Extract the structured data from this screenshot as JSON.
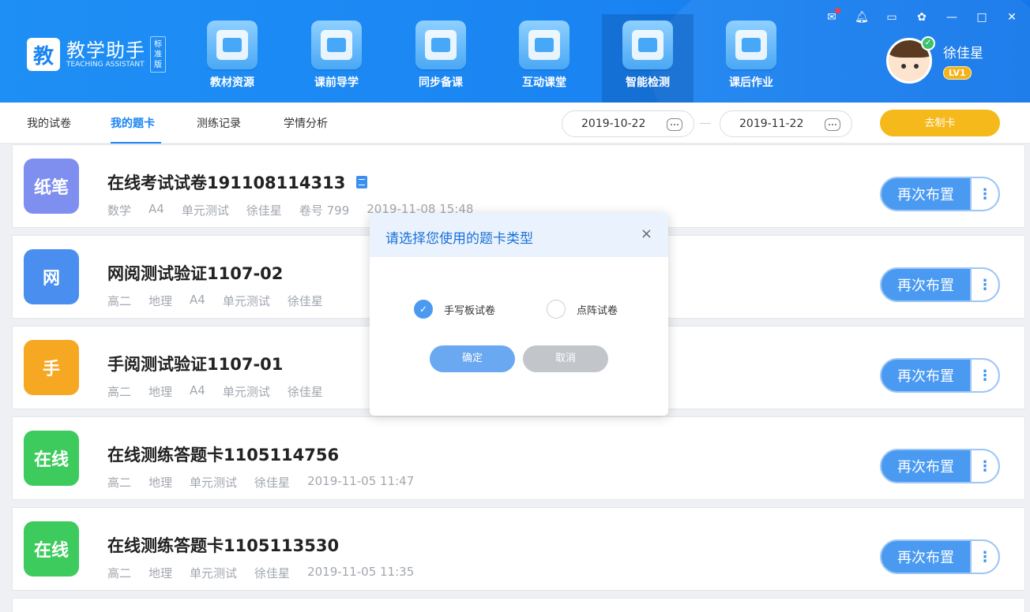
{
  "app": {
    "logo_char": "教",
    "name": "教学助手",
    "name_en": "TEACHING ASSISTANT",
    "edition": [
      "标",
      "准",
      "版"
    ]
  },
  "nav": [
    {
      "label": "教材资源",
      "icon": "textbook-icon"
    },
    {
      "label": "课前导学",
      "icon": "upload-guide-icon"
    },
    {
      "label": "同步备课",
      "icon": "pencil-paper-icon"
    },
    {
      "label": "互动课堂",
      "icon": "monitor-icon"
    },
    {
      "label": "智能检测",
      "icon": "clipboard-check-icon",
      "active": true
    },
    {
      "label": "课后作业",
      "icon": "backpack-icon"
    }
  ],
  "user": {
    "name": "徐佳星",
    "level": "LV1"
  },
  "tabs": [
    {
      "label": "我的试卷"
    },
    {
      "label": "我的题卡",
      "active": true
    },
    {
      "label": "测练记录"
    },
    {
      "label": "学情分析"
    }
  ],
  "filter": {
    "date_from": "2019-10-22",
    "date_to": "2019-11-22",
    "make_card_label": "去制卡"
  },
  "list": [
    {
      "badge": "纸笔",
      "badge_color": "#7f8ff0",
      "title": "在线考试试卷191108114313",
      "has_doc_icon": true,
      "meta": [
        "数学",
        "A4",
        "单元测试",
        "徐佳星",
        "卷号 799",
        "2019-11-08 15:48"
      ]
    },
    {
      "badge": "网",
      "badge_color": "#4a8ff0",
      "title": "网阅测试验证1107-02",
      "meta": [
        "高二",
        "地理",
        "A4",
        "单元测试",
        "徐佳星"
      ]
    },
    {
      "badge": "手",
      "badge_color": "#f7a823",
      "title": "手阅测试验证1107-01",
      "meta": [
        "高二",
        "地理",
        "A4",
        "单元测试",
        "徐佳星"
      ]
    },
    {
      "badge": "在线",
      "badge_color": "#3ecb5e",
      "title": "在线测练答题卡1105114756",
      "meta": [
        "高二",
        "地理",
        "单元测试",
        "徐佳星",
        "2019-11-05 11:47"
      ]
    },
    {
      "badge": "在线",
      "badge_color": "#3ecb5e",
      "title": "在线测练答题卡1105113530",
      "meta": [
        "高二",
        "地理",
        "单元测试",
        "徐佳星",
        "2019-11-05 11:35"
      ]
    }
  ],
  "row_action": {
    "assign_label": "再次布置",
    "more_label": "⋮"
  },
  "modal": {
    "title": "请选择您使用的题卡类型",
    "close": "×",
    "options": [
      {
        "label": "手写板试卷",
        "checked": true
      },
      {
        "label": "点阵试卷",
        "checked": false
      }
    ],
    "ok_label": "确定",
    "cancel_label": "取消"
  },
  "colors": {
    "primary": "#1a84f2",
    "accent": "#f6b91b"
  }
}
